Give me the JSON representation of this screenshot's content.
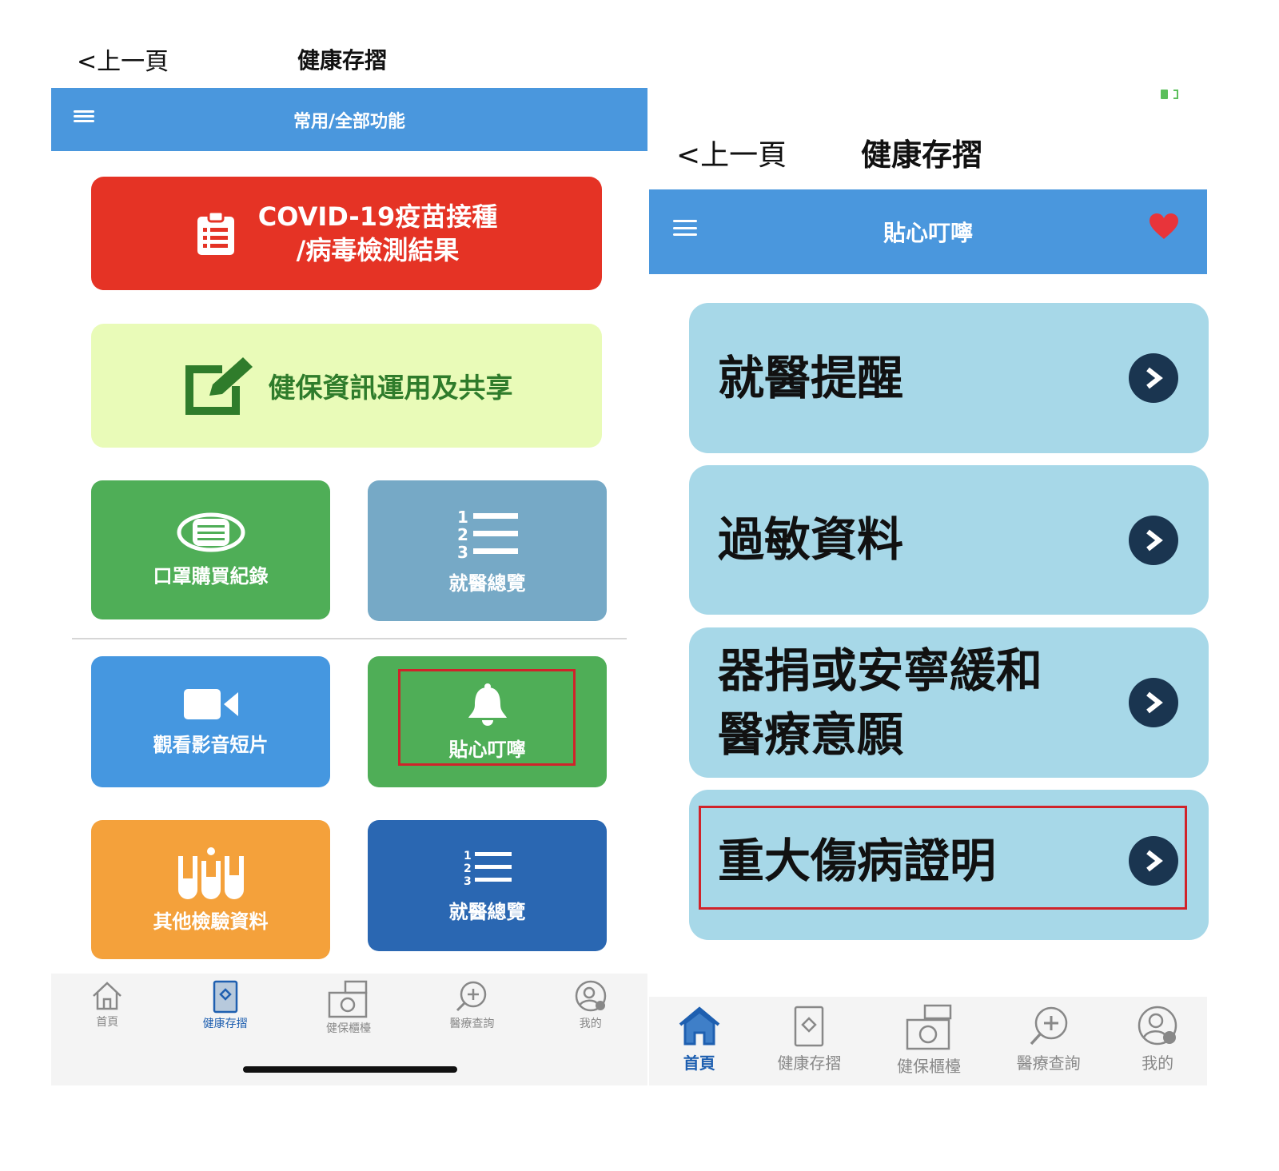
{
  "left": {
    "back_label": "<上一頁",
    "page_title": "健康存摺",
    "bar_title": "常用/全部功能",
    "covid_line1": "COVID-19疫苗接種",
    "covid_line2": "/病毒檢測結果",
    "share_label": "健保資訊運用及共享",
    "tiles": {
      "mask": "口罩購買紀錄",
      "overview1": "就醫總覽",
      "video": "觀看影音短片",
      "reminder": "貼心叮嚀",
      "labs": "其他檢驗資料",
      "overview2": "就醫總覽"
    },
    "nav": [
      "首頁",
      "健康存摺",
      "健保櫃檯",
      "醫療查詢",
      "我的"
    ]
  },
  "right": {
    "back_label": "<上一頁",
    "page_title": "健康存摺",
    "bar_title": "貼心叮嚀",
    "cards": [
      "就醫提醒",
      "過敏資料",
      "器捐或安寧緩和\n醫療意願",
      "重大傷病證明"
    ],
    "nav": [
      "首頁",
      "健康存摺",
      "健保櫃檯",
      "醫療查詢",
      "我的"
    ]
  },
  "colors": {
    "bar_blue": "#4a97dd",
    "covid_red": "#e53325",
    "share_lime": "#e9fbb8",
    "share_green": "#2f7c2b",
    "tile_green": "#4fae57",
    "tile_steel": "#76a9c6",
    "tile_blue": "#4597e0",
    "tile_orange": "#f4a13b",
    "tile_navy": "#2a67b2",
    "card_light_blue": "#a7d8e8",
    "highlight_red": "#d0232a",
    "heart_red": "#e8343a"
  },
  "icons": {
    "covid": "clipboard-icon",
    "share": "edit-icon",
    "mask": "mask-icon",
    "overview": "numbered-list-icon",
    "video": "video-camera-icon",
    "reminder": "bell-icon",
    "labs": "test-tubes-icon",
    "favorite": "heart-icon",
    "card_arrow": "chevron-right-circle-icon"
  }
}
